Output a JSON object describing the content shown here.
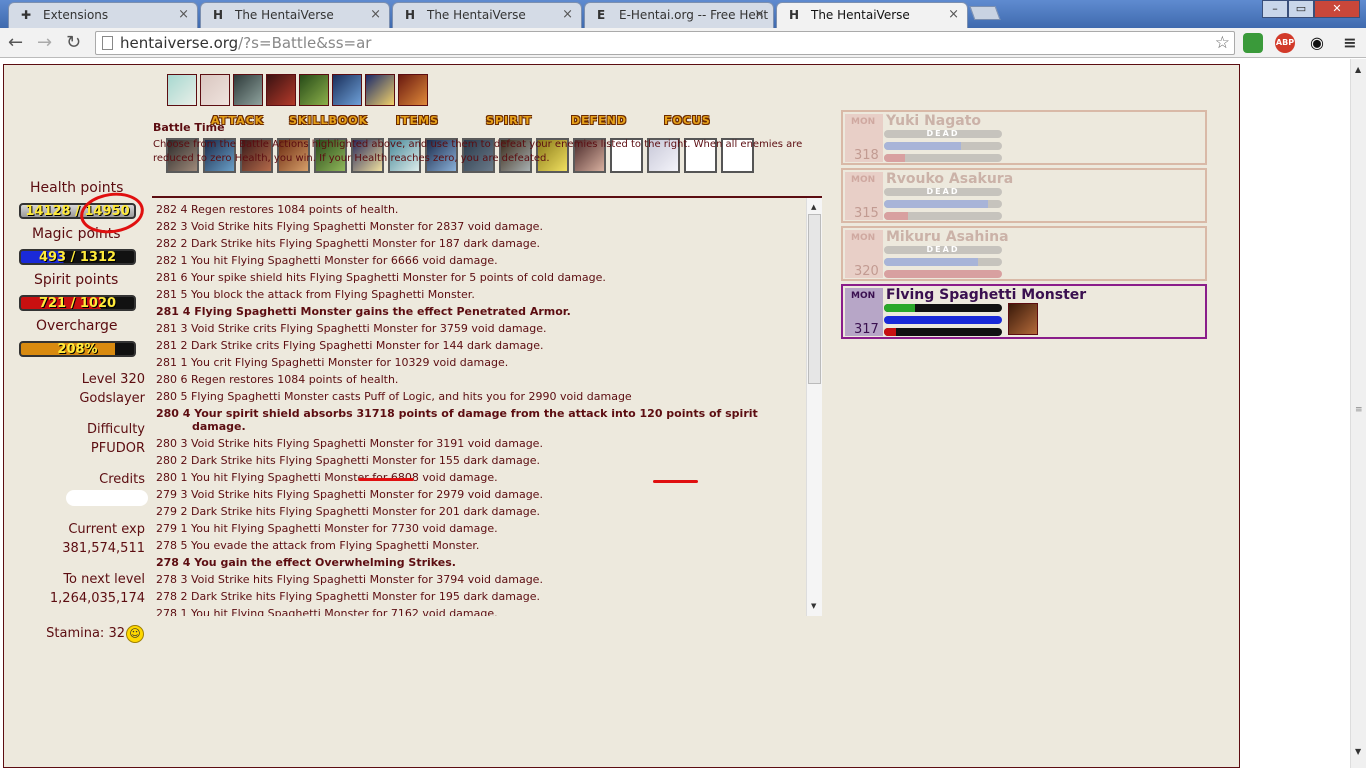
{
  "browser": {
    "tabs": [
      {
        "icon": "puzzle-icon",
        "label": "Extensions"
      },
      {
        "icon": "hv-logo-icon",
        "label": "The HentaiVerse"
      },
      {
        "icon": "hv-logo-icon",
        "label": "The HentaiVerse"
      },
      {
        "icon": "eh-logo-icon",
        "label": "E-Hentai.org -- Free Hent"
      },
      {
        "icon": "hv-logo-icon",
        "label": "The HentaiVerse"
      }
    ],
    "url_host": "hentaiverse.org",
    "url_path": "/?s=Battle&ss=ar",
    "close_glyph": "×",
    "ext_labels": [
      "",
      "ABP",
      "",
      ""
    ]
  },
  "menus": [
    "ATTACK",
    "SKILLBOOK",
    "ITEMS",
    "SPIRIT",
    "DEFEND",
    "FOCUS"
  ],
  "player": {
    "health_label": "Health points",
    "health_value": "14128 / 14950",
    "health_fraction": 0.945,
    "magic_label": "Magic points",
    "magic_value": "493 / 1312",
    "magic_fraction": 0.376,
    "spirit_label": "Spirit points",
    "spirit_value": "721 / 1020",
    "spirit_fraction": 0.707,
    "overcharge_label": "Overcharge",
    "overcharge_value": "208%",
    "overcharge_fraction": 0.832,
    "level_line1": "Level 320",
    "level_line2": "Godslayer",
    "difficulty_label": "Difficulty",
    "difficulty_value": "PFUDOR",
    "credits_label": "Credits",
    "exp_label": "Current exp",
    "exp_value": "381,574,511",
    "next_label": "To next level",
    "next_value": "1,264,035,174",
    "stamina": "Stamina: 32"
  },
  "battle": {
    "title": "Battle Time",
    "description": "Choose from the Battle Actions highlighted above, and use them to defeat your enemies listed to the right. When all enemies are reduced to zero Health, you win. If your Health reaches zero, you are defeated."
  },
  "log": [
    {
      "text": "282 4 Regen restores 1084 points of health.",
      "bold": false
    },
    {
      "text": "282 3 Void Strike hits Flying Spaghetti Monster for 2837 void damage.",
      "bold": false
    },
    {
      "text": "282 2 Dark Strike hits Flying Spaghetti Monster for 187 dark damage.",
      "bold": false
    },
    {
      "text": "282 1 You hit Flying Spaghetti Monster for 6666 void damage.",
      "bold": false
    },
    {
      "text": "281 6 Your spike shield hits Flying Spaghetti Monster for 5 points of cold damage.",
      "bold": false
    },
    {
      "text": "281 5 You block the attack from Flying Spaghetti Monster.",
      "bold": false
    },
    {
      "text": "281 4 Flying Spaghetti Monster gains the effect Penetrated Armor.",
      "bold": true
    },
    {
      "text": "281 3 Void Strike crits Flying Spaghetti Monster for 3759 void damage.",
      "bold": false
    },
    {
      "text": "281 2 Dark Strike crits Flying Spaghetti Monster for 144 dark damage.",
      "bold": false
    },
    {
      "text": "281 1 You crit Flying Spaghetti Monster for 10329 void damage.",
      "bold": false
    },
    {
      "text": "280 6 Regen restores 1084 points of health.",
      "bold": false
    },
    {
      "text": "280 5 Flying Spaghetti Monster casts Puff of Logic, and hits you for 2990 void damage",
      "bold": false
    },
    {
      "text": "280 4 Your spirit shield absorbs 31718 points of damage from the attack into 120 points of spirit damage.",
      "bold": true,
      "wrap": true
    },
    {
      "text": "280 3 Void Strike hits Flying Spaghetti Monster for 3191 void damage.",
      "bold": false
    },
    {
      "text": "280 2 Dark Strike hits Flying Spaghetti Monster for 155 dark damage.",
      "bold": false
    },
    {
      "text": "280 1 You hit Flying Spaghetti Monster for 6808 void damage.",
      "bold": false
    },
    {
      "text": "279 3 Void Strike hits Flying Spaghetti Monster for 2979 void damage.",
      "bold": false
    },
    {
      "text": "279 2 Dark Strike hits Flying Spaghetti Monster for 201 dark damage.",
      "bold": false
    },
    {
      "text": "279 1 You hit Flying Spaghetti Monster for 7730 void damage.",
      "bold": false
    },
    {
      "text": "278 5 You evade the attack from Flying Spaghetti Monster.",
      "bold": false
    },
    {
      "text": "278 4 You gain the effect Overwhelming Strikes.",
      "bold": true
    },
    {
      "text": "278 3 Void Strike hits Flying Spaghetti Monster for 3794 void damage.",
      "bold": false
    },
    {
      "text": "278 2 Dark Strike hits Flying Spaghetti Monster for 195 dark damage.",
      "bold": false
    },
    {
      "text": "278 1 You hit Flying Spaghetti Monster for 7162 void damage.",
      "bold": false
    }
  ],
  "monsters": [
    {
      "tag": "MON",
      "name": "Yuki Nagato",
      "level": "318",
      "status": "DEAD",
      "mp": 0.65,
      "sp": 0.18
    },
    {
      "tag": "MON",
      "name": "Rvouko Asakura",
      "level": "315",
      "status": "DEAD",
      "mp": 0.88,
      "sp": 0.2
    },
    {
      "tag": "MON",
      "name": "Mikuru Asahina",
      "level": "320",
      "status": "DEAD",
      "mp": 0.8,
      "sp": 1.0
    },
    {
      "tag": "MON",
      "name": "Flving Spaghetti Monster",
      "level": "317",
      "status": "",
      "hp": 0.26,
      "mp": 1.0,
      "sp": 0.1
    }
  ],
  "colors": {
    "page_bg": "#ede9dd",
    "text": "#5c0d11",
    "accent_active": "#8a1d8a",
    "annotation": "#e01010"
  }
}
